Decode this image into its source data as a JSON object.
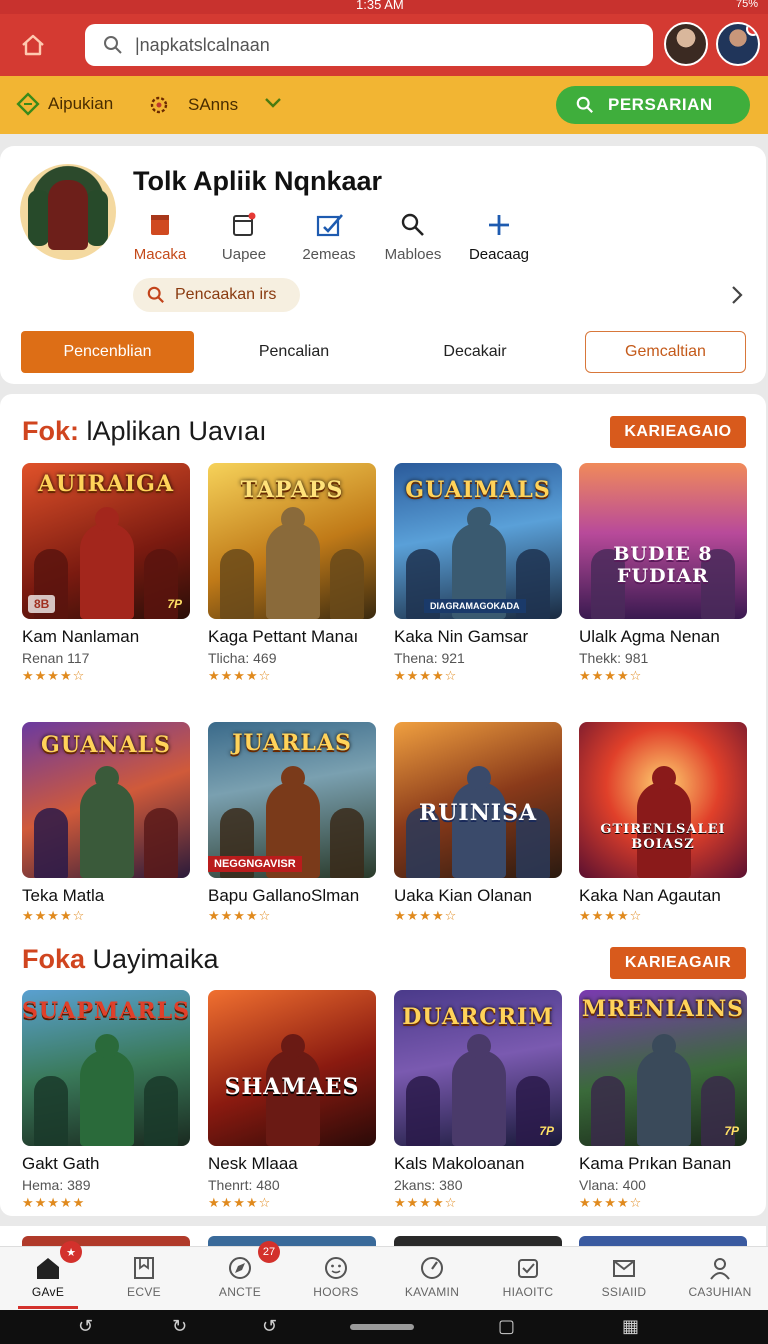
{
  "status_bar": {
    "time": "1:35 AM",
    "right": "75%"
  },
  "header": {
    "search_placeholder": "|napkatslcalnaan"
  },
  "orange_bar": {
    "item1": "Aipukian",
    "item2": "SAnns",
    "action": "PERSARIAN"
  },
  "profile": {
    "title": "Tolk Apliik Nqnkaar",
    "quick_actions": [
      {
        "label": "Macaka",
        "icon": "bookmark-icon"
      },
      {
        "label": "Uapee",
        "icon": "window-icon"
      },
      {
        "label": "2emeas",
        "icon": "edit-icon"
      },
      {
        "label": "Mabloes",
        "icon": "search-icon"
      },
      {
        "label": "Deacaag",
        "icon": "plus-icon"
      }
    ],
    "chip": "Pencaakan irs",
    "tabs": [
      "Pencenblian",
      "Pencalian",
      "Decakair",
      "Gemcaltian"
    ]
  },
  "section1": {
    "title_accent": "Fok:",
    "title_rest": " lAplikan Uavıaı",
    "button": "KARIEAGAIO",
    "games": [
      {
        "logo": "AUIRAIGA",
        "name": "Kam Nanlaman",
        "sub": "Renan 117",
        "rating": "★★★★☆",
        "badge": "8B",
        "age": "7P"
      },
      {
        "logo": "TAPAPS",
        "name": "Kaga Pettant Manaı",
        "sub": "Tlicha: 469",
        "rating": "★★★★☆"
      },
      {
        "logo": "GUAIMALS",
        "name": "Kaka Nin Gamsar",
        "sub": "Thena: 921",
        "rating": "★★★★☆",
        "banner": "DIAGRAMAGOKADA"
      },
      {
        "logo": "BUDIE 8 FUDIAR",
        "name": "Ulalk Agma Nenan",
        "sub": "Thekk: 981",
        "rating": "★★★★☆"
      },
      {
        "logo": "GUANALS",
        "name": "Teka Matla",
        "sub": "",
        "rating": "★★★★☆"
      },
      {
        "logo": "JUARLAS",
        "name": "Bapu GallanoSlman",
        "sub": "",
        "rating": "★★★★☆",
        "banner": "NEGGNGAVISR"
      },
      {
        "logo": "RUINISA",
        "name": "Uaka Kian Olanan",
        "sub": "",
        "rating": "★★★★☆"
      },
      {
        "logo": "GTIRENLSALEI BOIASZ",
        "name": "Kaka Nan Agautan",
        "sub": "",
        "rating": "★★★★☆"
      }
    ]
  },
  "section2": {
    "title_accent": "Foka",
    "title_rest": " Uayimaika",
    "button": "KARIEAGAIR",
    "games": [
      {
        "logo": "SUAPMARLS",
        "name": "Gakt Gath",
        "sub": "Hema: 389",
        "rating": "★★★★★"
      },
      {
        "logo": "SHAMAES",
        "name": "Nesk Mlaaa",
        "sub": "Thenrt: 480",
        "rating": "★★★★☆"
      },
      {
        "logo": "DUARCRIM",
        "name": "Kals Makoloanan",
        "sub": "2kans: 380",
        "rating": "★★★★☆",
        "age": "7P"
      },
      {
        "logo": "MRENIAINS",
        "name": "Kama Prıkan Banan",
        "sub": "Vlana: 400",
        "rating": "★★★★☆",
        "age": "7P"
      }
    ]
  },
  "bottom_nav": [
    {
      "label": "GAvE",
      "icon": "home-icon",
      "badge": "★"
    },
    {
      "label": "ECVE",
      "icon": "bookmark-icon"
    },
    {
      "label": "ANCTE",
      "icon": "compass-icon",
      "badge": "27"
    },
    {
      "label": "HOORS",
      "icon": "face-icon"
    },
    {
      "label": "KAVAMIN",
      "icon": "gauge-icon"
    },
    {
      "label": "HIAOITC",
      "icon": "check-shield-icon"
    },
    {
      "label": "SSIAIID",
      "icon": "mail-icon"
    },
    {
      "label": "CA3UHIAN",
      "icon": "user-icon"
    }
  ],
  "colors": {
    "header": "#d43a32",
    "orange_bar": "#f2b533",
    "accent": "#d85a1c",
    "green": "#3fae3c"
  }
}
